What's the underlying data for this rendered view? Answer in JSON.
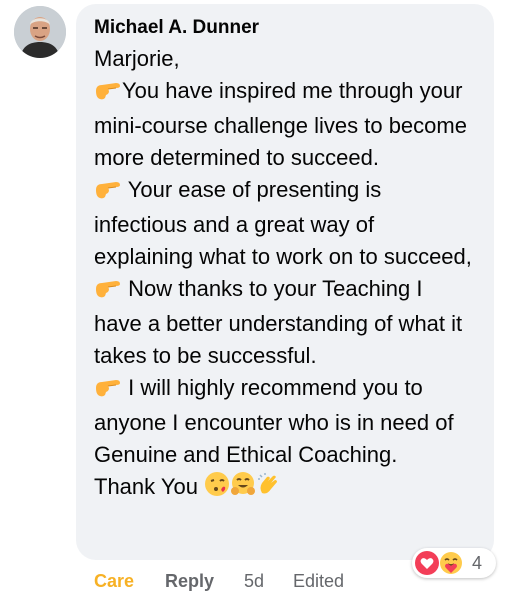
{
  "comment": {
    "author": "Michael A. Dunner",
    "greeting": "Marjorie,",
    "p1": "You have inspired me through your mini-course challenge lives to become more determined to succeed.",
    "p2": " Your ease of presenting is infectious and a great way of explaining what to work on to succeed,",
    "p3": " Now thanks to your Teaching I have a better understanding of what it takes to be successful.",
    "p4": " I will highly recommend you to anyone I encounter who is in need of Genuine and Ethical Coaching.",
    "p5": "Thank You "
  },
  "reactions": {
    "count": "4"
  },
  "actions": {
    "care": "Care",
    "reply": "Reply",
    "time": "5d",
    "edited": "Edited"
  },
  "colors": {
    "bubble": "#f0f2f5",
    "care": "#f7b125",
    "meta": "#65676b",
    "heart": "#f33e58"
  }
}
